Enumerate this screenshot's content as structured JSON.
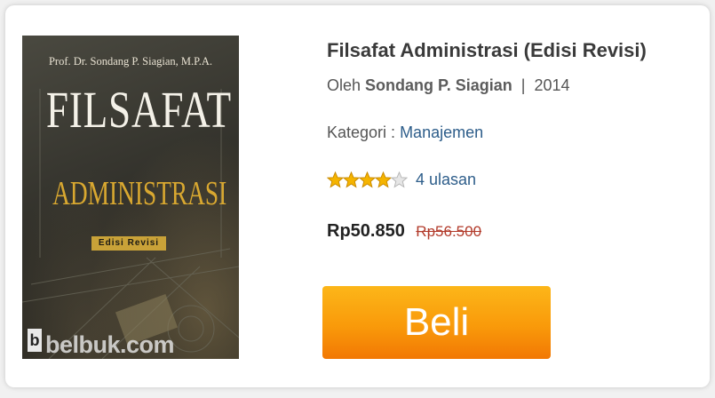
{
  "cover": {
    "author": "Prof. Dr. Sondang P. Siagian, M.P.A.",
    "title_line1": "FILSAFAT",
    "title_line2": "ADMINISTRASI",
    "edition": "Edisi Revisi",
    "watermark": "belbuk.com",
    "badge": "b"
  },
  "book": {
    "title": "Filsafat Administrasi (Edisi Revisi)",
    "by_label": "Oleh",
    "author": "Sondang P. Siagian",
    "separator": "|",
    "year": "2014",
    "category_label": "Kategori :",
    "category": "Manajemen"
  },
  "rating": {
    "value": 4,
    "max": 5,
    "reviews_text": "4 ulasan",
    "star_color": "#f5b400"
  },
  "pricing": {
    "price": "Rp50.850",
    "old_price": "Rp56.500"
  },
  "actions": {
    "buy_label": "Beli",
    "buy_color": "#f99a0a"
  }
}
